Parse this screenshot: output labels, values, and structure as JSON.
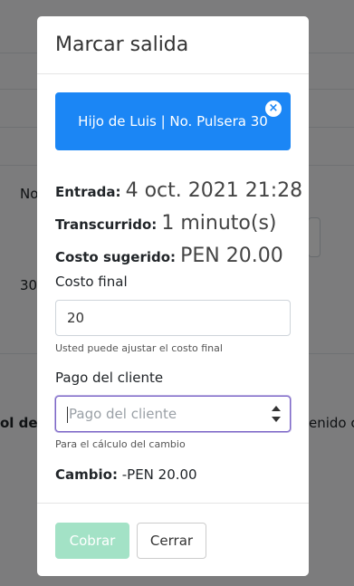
{
  "background": {
    "col_fragment": "No",
    "row_fragment": "30",
    "left_fragment": "ol de",
    "right_fragment": "enido c"
  },
  "modal": {
    "title": "Marcar salida",
    "alert": {
      "text": "Hijo de Luis | No. Pulsera 30",
      "close_symbol": "×"
    },
    "entrada": {
      "label": "Entrada:",
      "value": "4 oct. 2021 21:28"
    },
    "transcurrido": {
      "label": "Transcurrido:",
      "value": "1 minuto(s)"
    },
    "costo_sugerido": {
      "label": "Costo sugerido:",
      "value": "PEN 20.00"
    },
    "costo_final": {
      "label": "Costo final",
      "value": "20",
      "help": "Usted puede ajustar el costo final"
    },
    "pago_cliente": {
      "label": "Pago del cliente",
      "value": "",
      "placeholder": "Pago del cliente",
      "help": "Para el cálculo del cambio"
    },
    "cambio": {
      "label": "Cambio:",
      "value": "-PEN 20.00"
    },
    "buttons": {
      "cobrar": "Cobrar",
      "cerrar": "Cerrar"
    }
  },
  "colors": {
    "alert_blue": "#1b86f5",
    "cobrar_disabled_green": "#a3e2c6",
    "focus_border": "#7a63c7"
  }
}
